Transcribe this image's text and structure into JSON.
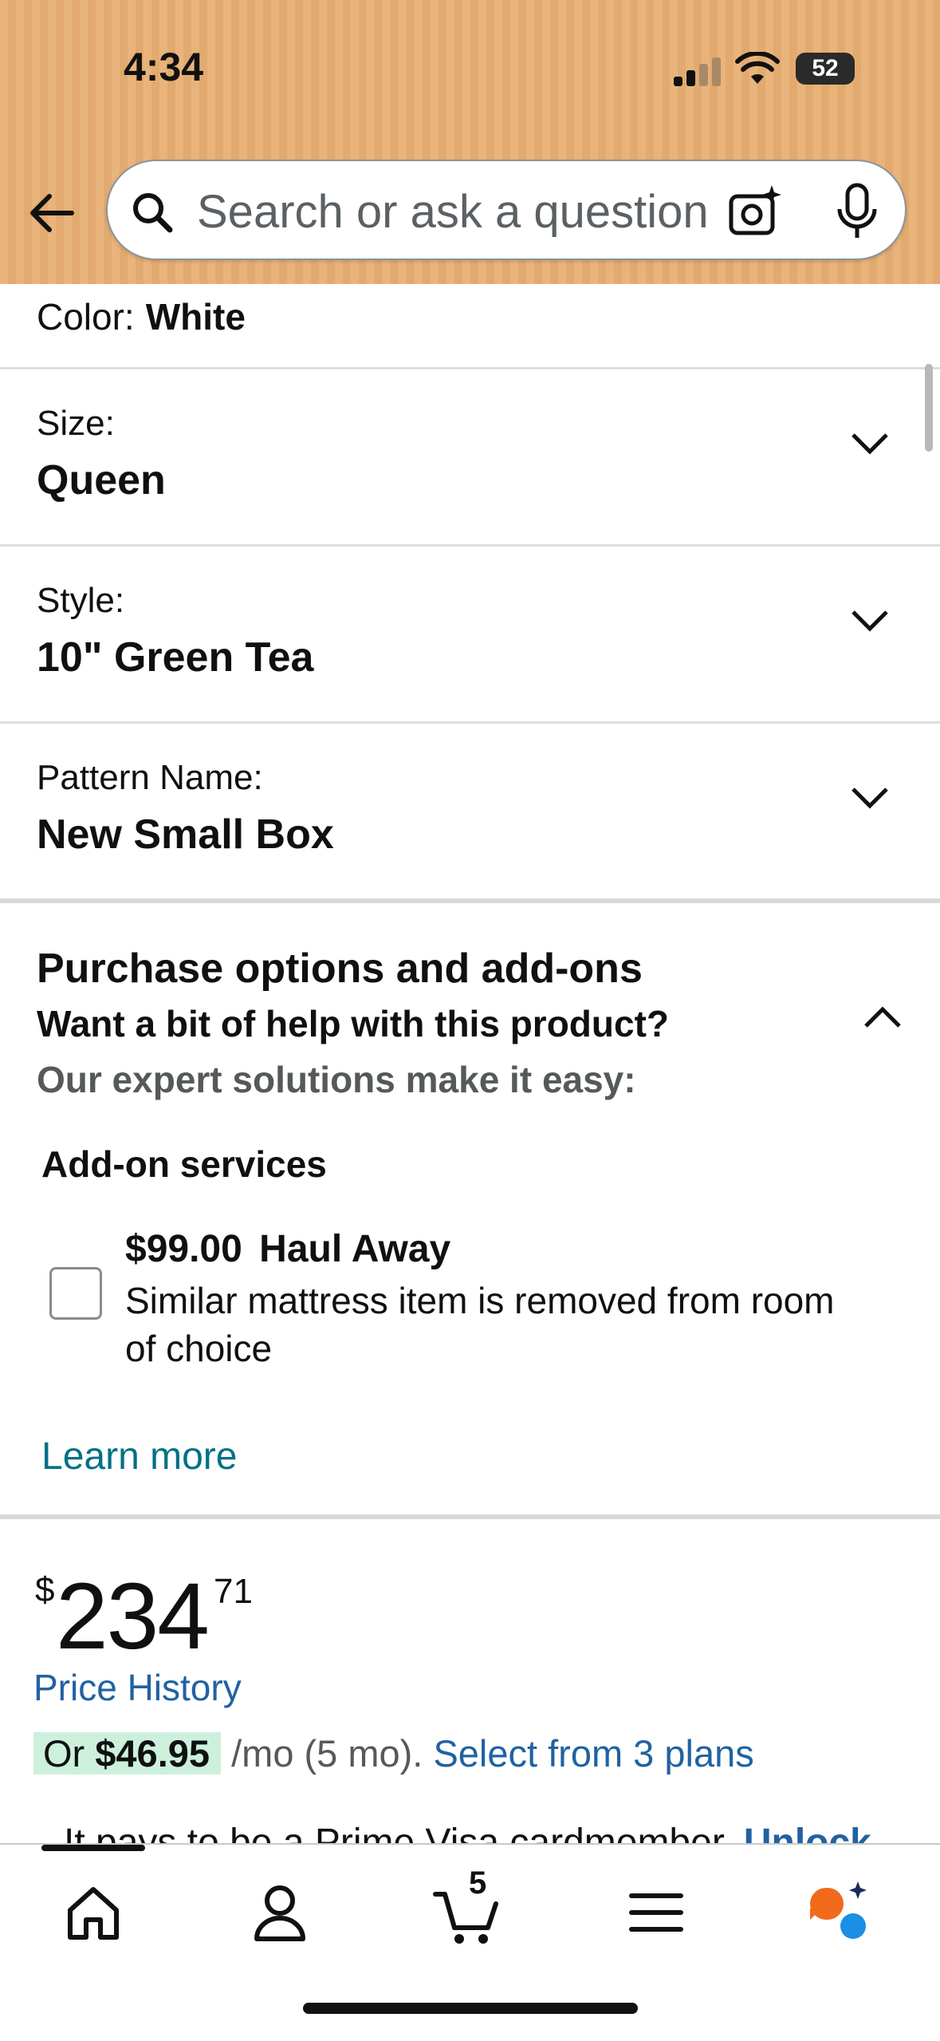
{
  "status_bar": {
    "time": "4:34",
    "battery": "52"
  },
  "search": {
    "placeholder": "Search or ask a question"
  },
  "options": {
    "color_label": "Color:",
    "color_value": "White",
    "size_label": "Size:",
    "size_value": "Queen",
    "style_label": "Style:",
    "style_value": "10\" Green Tea",
    "pattern_label": "Pattern Name:",
    "pattern_value": "New Small Box"
  },
  "purchase": {
    "title": "Purchase options and add-ons",
    "subtitle": "Want a bit of help with this product?",
    "subtitle2": "Our expert solutions make it easy:",
    "addon_title": "Add-on services",
    "addon_price": "$99.00",
    "addon_name": "Haul Away",
    "addon_desc": "Similar mattress item is removed from room of choice",
    "addon_checked": false,
    "learn_more": "Learn more"
  },
  "price": {
    "symbol": "$",
    "whole": "234",
    "fraction": "71",
    "history_link": "Price History",
    "plan_prefix": "Or ",
    "plan_amount": "$46.95",
    "plan_term": " /mo (5 mo).",
    "plan_link": "Select from 3 plans",
    "prime_text": "It pays to be a Prime Visa cardmember.",
    "prime_link": "Unlock"
  },
  "tabbar": {
    "cart_count": "5"
  }
}
